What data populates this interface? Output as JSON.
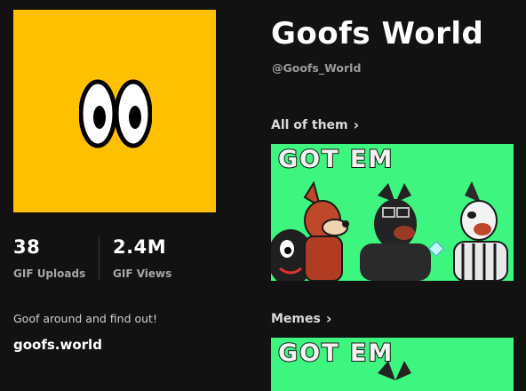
{
  "profile": {
    "name": "Goofs World",
    "handle": "@Goofs_World",
    "brand_color": "#ffc000",
    "bio": "Goof around and find out!",
    "website": "goofs.world"
  },
  "stats": [
    {
      "value": "38",
      "label": "GIF Uploads"
    },
    {
      "value": "2.4M",
      "label": "GIF Views"
    }
  ],
  "sections": [
    {
      "title": "All of them",
      "thumb_caption": "GOT EM"
    },
    {
      "title": "Memes",
      "thumb_caption": "GOT EM"
    }
  ]
}
